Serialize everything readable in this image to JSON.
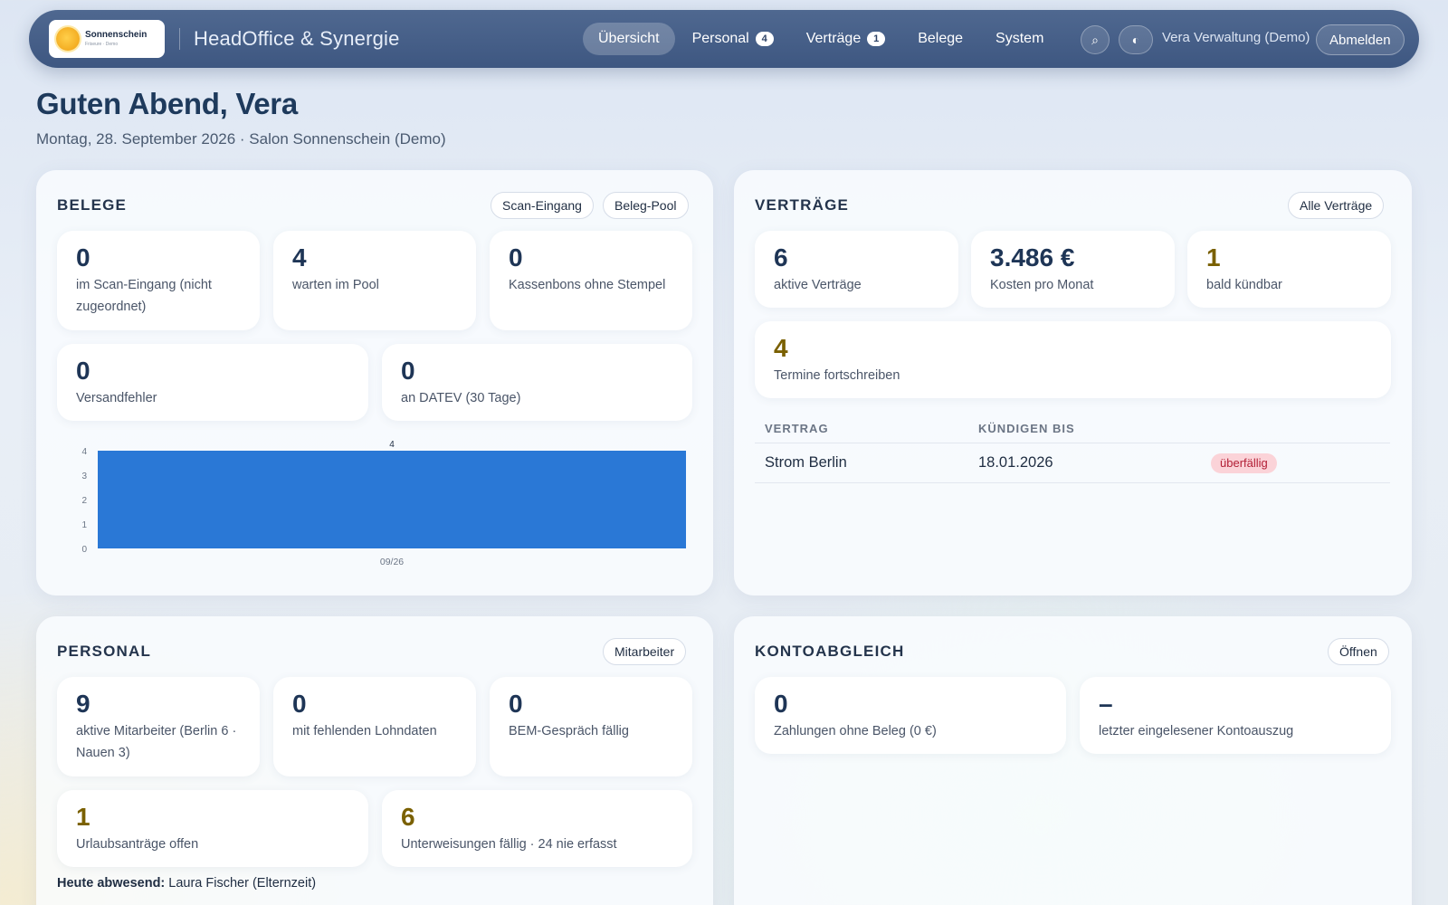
{
  "nav": {
    "logo_name": "Sonnenschein",
    "logo_sub": "Friseure · Demo",
    "app_title": "HeadOffice & Synergie",
    "links": [
      {
        "label": "Übersicht",
        "badge": "",
        "active": true
      },
      {
        "label": "Personal",
        "badge": "4",
        "active": false
      },
      {
        "label": "Verträge",
        "badge": "1",
        "active": false
      },
      {
        "label": "Belege",
        "badge": "",
        "active": false
      },
      {
        "label": "System",
        "badge": "",
        "active": false
      }
    ],
    "search_icon": "⌕",
    "theme_icon": "◐",
    "user": "Vera Verwaltung (Demo)",
    "logout": "Abmelden"
  },
  "greeting": "Guten Abend, Vera",
  "subline": "Montag, 28. September 2026 · Salon Sonnenschein (Demo)",
  "belege": {
    "title": "BELEGE",
    "btn_scan": "Scan-Eingang",
    "btn_pool": "Beleg-Pool",
    "stats": [
      {
        "value": "0",
        "label": "im Scan-Eingang (nicht zugeordnet)"
      },
      {
        "value": "4",
        "label": "warten im Pool"
      },
      {
        "value": "0",
        "label": "Kassenbons ohne Stempel"
      },
      {
        "value": "0",
        "label": "Versandfehler"
      },
      {
        "value": "0",
        "label": "an DATEV (30 Tage)"
      }
    ]
  },
  "chart_data": {
    "type": "bar",
    "categories": [
      "09/26"
    ],
    "values": [
      4
    ],
    "ylim": [
      0,
      4
    ],
    "yticks": [
      0,
      1,
      2,
      3,
      4
    ],
    "title": "",
    "xlabel": "",
    "ylabel": "",
    "bar_color": "#2a78d6",
    "grid": false
  },
  "vertraege": {
    "title": "VERTRÄGE",
    "btn_all": "Alle Verträge",
    "stats": [
      {
        "value": "6",
        "label": "aktive Verträge"
      },
      {
        "value": "3.486 €",
        "label": "Kosten pro Monat"
      },
      {
        "value": "1",
        "label": "bald kündbar"
      },
      {
        "value": "4",
        "label": "Termine fortschreiben"
      }
    ],
    "table": {
      "col_contract": "VERTRAG",
      "col_cancel": "KÜNDIGEN BIS",
      "rows": [
        {
          "contract": "Strom Berlin",
          "date": "18.01.2026",
          "status": "überfällig"
        }
      ]
    }
  },
  "personal": {
    "title": "PERSONAL",
    "btn_staff": "Mitarbeiter",
    "stats": [
      {
        "value": "9",
        "label": "aktive Mitarbeiter (Berlin 6 · Nauen 3)"
      },
      {
        "value": "0",
        "label": "mit fehlenden Lohndaten"
      },
      {
        "value": "0",
        "label": "BEM-Gespräch fällig"
      },
      {
        "value": "1",
        "label": "Urlaubsanträge offen"
      },
      {
        "value": "6",
        "label": "Unterweisungen fällig · 24 nie erfasst"
      }
    ],
    "absent_label": "Heute abwesend:",
    "absent_value": "Laura Fischer (Elternzeit)"
  },
  "konto": {
    "title": "KONTOABGLEICH",
    "btn_open": "Öffnen",
    "stats": [
      {
        "value": "0",
        "label": "Zahlungen ohne Beleg (0 €)"
      },
      {
        "value": "–",
        "label": "letzter eingelesener Kontoauszug"
      }
    ]
  }
}
